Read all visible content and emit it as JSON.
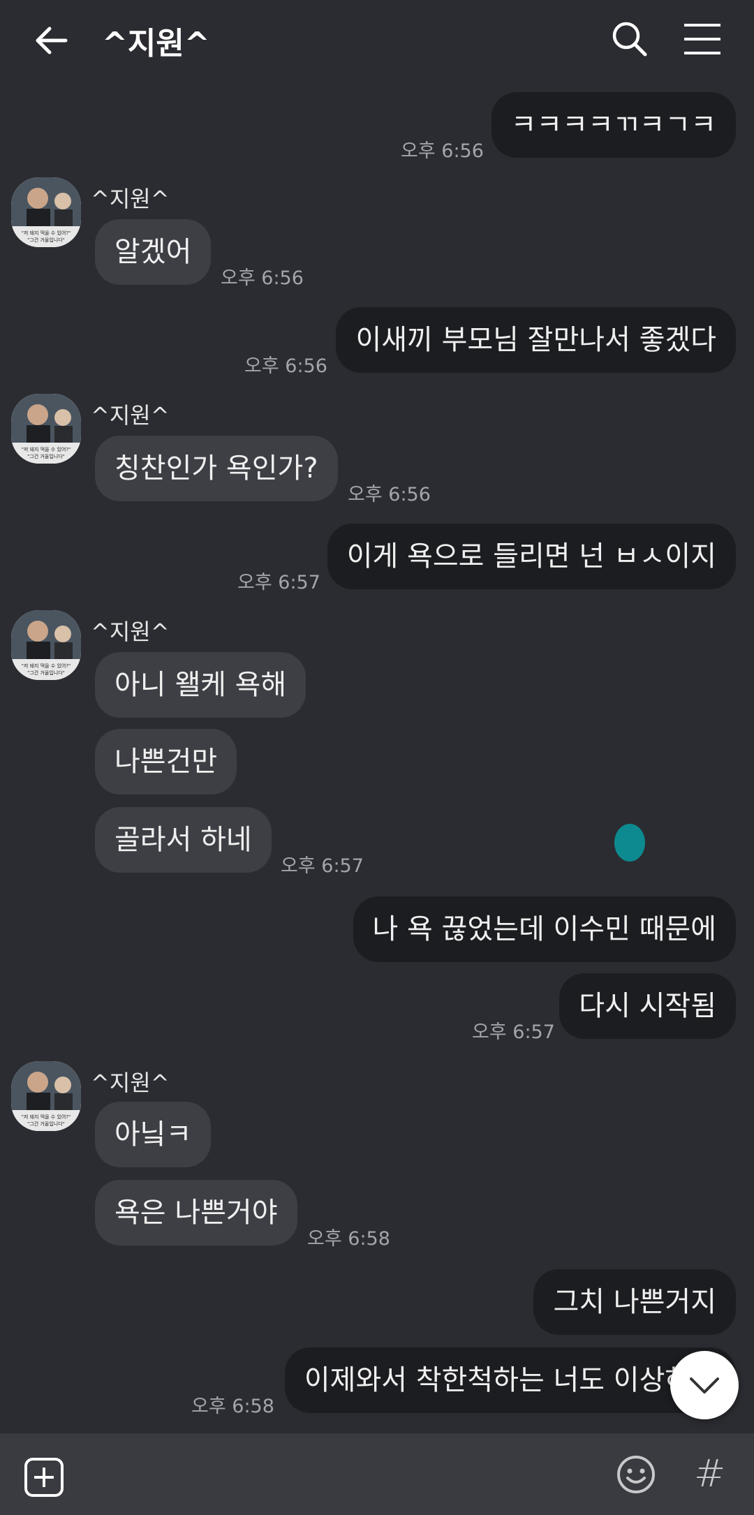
{
  "header": {
    "title": "^지원^",
    "back_icon": "arrow-left-icon",
    "search_icon": "search-icon",
    "menu_icon": "hamburger-menu-icon"
  },
  "messages": [
    {
      "side": "out",
      "text": "ㅋㅋㅋㅋㄲㅋㄱㅋ",
      "time": "오후 6:56"
    },
    {
      "side": "in",
      "sender": "^지원^",
      "text": "알겠어",
      "time": "오후 6:56"
    },
    {
      "side": "out",
      "text": "이새끼 부모님 잘만나서 좋겠다",
      "time": "오후 6:56"
    },
    {
      "side": "in",
      "sender": "^지원^",
      "text": "칭찬인가 욕인가?",
      "time": "오후 6:56"
    },
    {
      "side": "out",
      "text": "이게 욕으로 들리면 넌 ㅂㅅ이지",
      "time": "오후 6:57"
    },
    {
      "side": "in",
      "sender": "^지원^",
      "text": "아니 왤케 욕해"
    },
    {
      "side": "in",
      "text": "나쁜건만"
    },
    {
      "side": "in",
      "text": "골라서 하네",
      "time": "오후 6:57"
    },
    {
      "side": "out",
      "text": "나 욕 끊었는데 이수민 때문에"
    },
    {
      "side": "out",
      "text": "다시 시작됨",
      "time": "오후 6:57"
    },
    {
      "side": "in",
      "sender": "^지원^",
      "text": "아닠ㅋ"
    },
    {
      "side": "in",
      "text": "욕은 나쁜거야",
      "time": "오후 6:58"
    },
    {
      "side": "out",
      "text": "그치 나쁜거지"
    },
    {
      "side": "out",
      "text": "이제와서 착한척하는 너도 이상하다",
      "time": "오후 6:58"
    }
  ],
  "avatar": {
    "caption_line1": "\"저 돼지 먹을 수 있어?\"",
    "caption_line2": "\"그건 거울입니다\""
  },
  "input_bar": {
    "plus_icon": "plus-square-icon",
    "emoji_icon": "emoji-icon",
    "hash_label": "#"
  },
  "scroll_button_icon": "chevron-down-icon",
  "colors": {
    "background": "#2b2c31",
    "incoming_bubble": "#3e3f45",
    "outgoing_bubble": "#1c1d21",
    "time_text": "#a4a5aa"
  }
}
